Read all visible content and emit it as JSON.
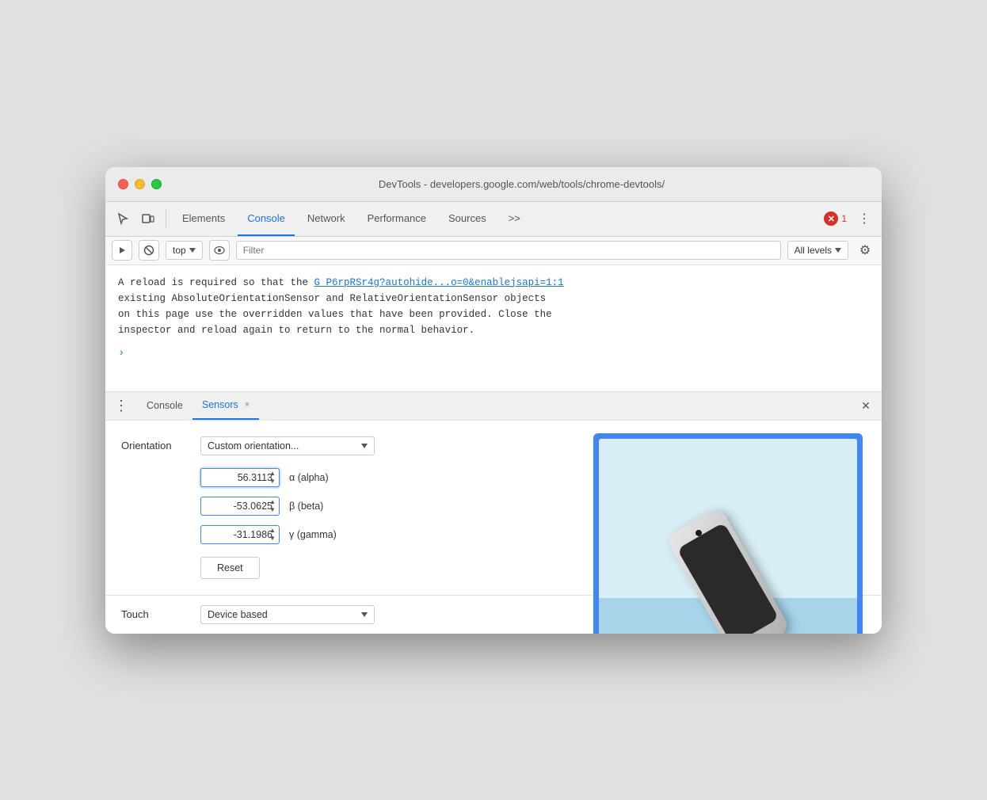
{
  "window": {
    "title": "DevTools - developers.google.com/web/tools/chrome-devtools/"
  },
  "titlebar": {
    "title": "DevTools - developers.google.com/web/tools/chrome-devtools/"
  },
  "toolbar": {
    "tabs": [
      {
        "id": "elements",
        "label": "Elements",
        "active": false
      },
      {
        "id": "console",
        "label": "Console",
        "active": true
      },
      {
        "id": "network",
        "label": "Network",
        "active": false
      },
      {
        "id": "performance",
        "label": "Performance",
        "active": false
      },
      {
        "id": "sources",
        "label": "Sources",
        "active": false
      }
    ],
    "more_label": ">>",
    "error_count": "1"
  },
  "filter_bar": {
    "context_value": "top",
    "filter_placeholder": "Filter",
    "levels_label": "All levels"
  },
  "console_output": {
    "line1": "A reload is required so that the ",
    "link_text": "G_P6rpRSr4g?autohide...o=0&enablejsapi=1:1",
    "line2": "existing AbsoluteOrientationSensor and RelativeOrientationSensor objects",
    "line3": "on this page use the overridden values that have been provided. Close the",
    "line4": "inspector and reload again to return to the normal behavior."
  },
  "bottom_panel": {
    "tabs": [
      {
        "id": "console",
        "label": "Console",
        "closeable": false
      },
      {
        "id": "sensors",
        "label": "Sensors",
        "closeable": true,
        "active": true
      }
    ],
    "close_label": "×"
  },
  "sensors": {
    "orientation_label": "Orientation",
    "orientation_dropdown": "Custom orientation...",
    "alpha_value": "56.3113",
    "alpha_label": "α (alpha)",
    "beta_value": "-53.0625",
    "beta_label": "β (beta)",
    "gamma_value": "-31.1986",
    "gamma_label": "γ (gamma)",
    "reset_label": "Reset",
    "touch_label": "Touch",
    "touch_dropdown": "Device based"
  },
  "icons": {
    "cursor": "↖",
    "device": "⊡",
    "execute": "▶",
    "block": "⊘",
    "eye": "◉",
    "gear": "⚙",
    "more_vert": "⋮",
    "dropdown_arrow": "▼",
    "stepper_up": "▲",
    "stepper_down": "▼",
    "close": "✕"
  }
}
